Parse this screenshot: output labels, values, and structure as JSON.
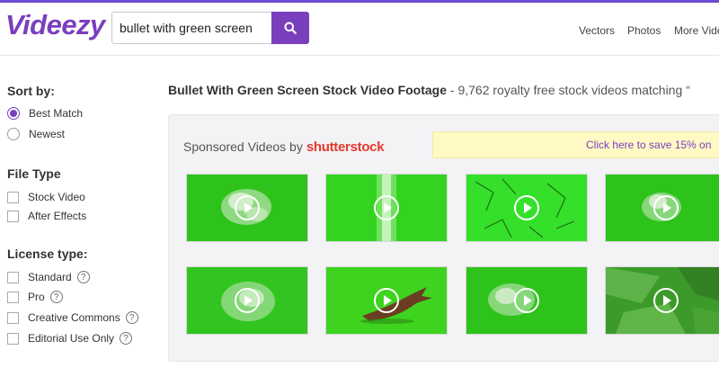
{
  "header": {
    "logo": "Videezy",
    "search_value": "bullet with green screen",
    "nav": [
      "Vectors",
      "Photos",
      "More Vide"
    ]
  },
  "sidebar": {
    "sort_title": "Sort by:",
    "sort_options": [
      "Best Match",
      "Newest"
    ],
    "filetype_title": "File Type",
    "filetype_options": [
      "Stock Video",
      "After Effects"
    ],
    "license_title": "License type:",
    "license_options": [
      "Standard",
      "Pro",
      "Creative Commons",
      "Editorial Use Only"
    ],
    "help_glyph": "?"
  },
  "main": {
    "title_bold": "Bullet With Green Screen Stock Video Footage",
    "title_rest": " - 9,762 royalty free stock videos matching “",
    "sponsored_label": "Sponsored Videos by",
    "sponsor_brand": "shutterstock",
    "promo_text": "Click here to save 15% on"
  },
  "colors": {
    "brand": "#7a3fbd",
    "green_screen": "#2fc81c",
    "promo_bg": "#fff9c4",
    "shutterstock_red": "#e5382f"
  }
}
